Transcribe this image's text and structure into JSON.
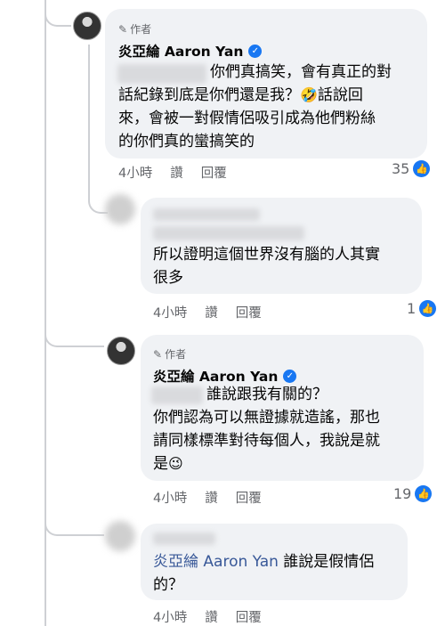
{
  "comments": [
    {
      "author_badge": "作者",
      "name": "炎亞綸 Aaron Yan",
      "lines": [
        "你們真搞笑，會有真正的對",
        "話紀錄到底是你們還是我？",
        "話說回",
        "來，會被一對假情侶吸引成為他們粉絲",
        "的你們真的蠻搞笑的"
      ],
      "emoji": "🤣",
      "time": "4小時",
      "like_label": "讚",
      "reply_label": "回覆",
      "reaction_count": "35"
    },
    {
      "lines": [
        "所以證明這個世界沒有腦的人其實",
        "很多"
      ],
      "time": "4小時",
      "like_label": "讚",
      "reply_label": "回覆",
      "reaction_count": "1"
    },
    {
      "author_badge": "作者",
      "name": "炎亞綸 Aaron Yan",
      "lines": [
        "誰說跟我有關的？",
        "你們認為可以無證據就造謠，那也",
        "請同樣標準對待每個人，我說是就",
        "是"
      ],
      "emoji": "😉",
      "time": "4小時",
      "like_label": "讚",
      "reply_label": "回覆",
      "reaction_count": "19"
    },
    {
      "mention": "炎亞綸 Aaron Yan",
      "lines": [
        "誰說是假情侶",
        "的？"
      ],
      "time": "4小時",
      "like_label": "讚",
      "reply_label": "回覆"
    }
  ],
  "colors": {
    "accent": "#1877f2",
    "bubble": "#f0f2f5",
    "meta": "#65676b",
    "mention": "#385898"
  },
  "icons": {
    "verified": "verified-badge-icon",
    "pencil": "pencil-icon",
    "like": "like-icon"
  }
}
